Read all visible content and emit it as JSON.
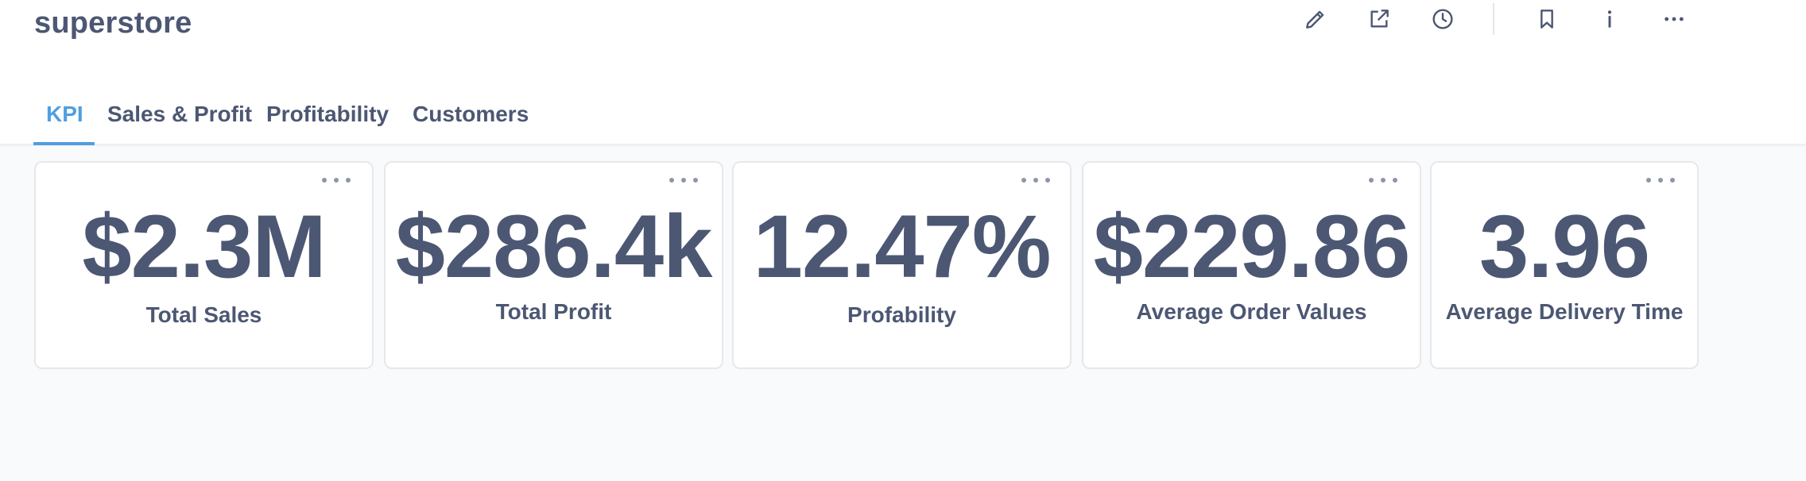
{
  "page": {
    "title": "superstore"
  },
  "toolbar": {
    "icons": [
      "pencil-icon",
      "share-icon",
      "clock-icon",
      "bookmark-icon",
      "info-icon",
      "more-icon"
    ]
  },
  "tabs": [
    {
      "label": "KPI",
      "active": true
    },
    {
      "label": "Sales & Profit",
      "active": false
    },
    {
      "label": "Profitability",
      "active": false
    },
    {
      "label": "Customers",
      "active": false
    }
  ],
  "kpis": [
    {
      "value": "$2.3M",
      "label": "Total Sales"
    },
    {
      "value": "$286.4k",
      "label": "Total Profit"
    },
    {
      "value": "12.47%",
      "label": "Profability"
    },
    {
      "value": "$229.86",
      "label": "Average Order Values"
    },
    {
      "value": "3.96",
      "label": "Average Delivery Time"
    }
  ],
  "colors": {
    "accent": "#509ee3",
    "text": "#4c5773",
    "background": "#f9fafb"
  }
}
